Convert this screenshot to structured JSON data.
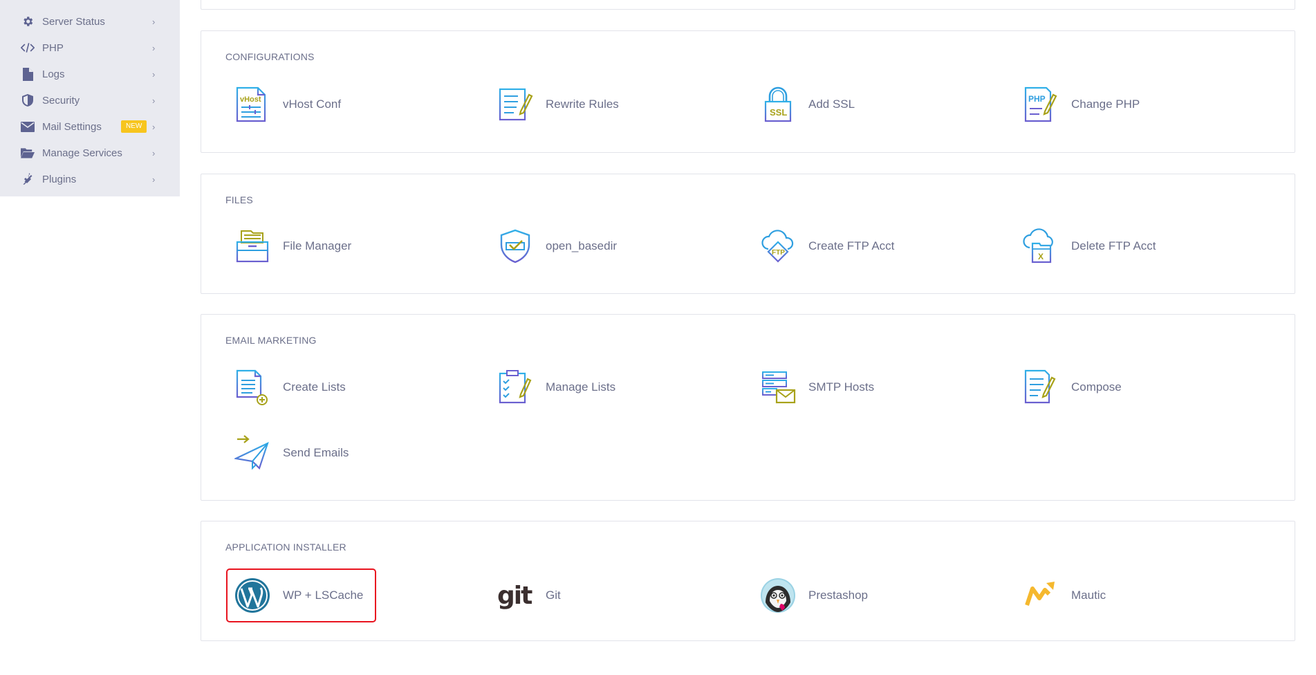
{
  "sidebar": {
    "items": [
      {
        "label": "Server Status",
        "icon": "gear-icon"
      },
      {
        "label": "PHP",
        "icon": "code-icon"
      },
      {
        "label": "Logs",
        "icon": "file-icon"
      },
      {
        "label": "Security",
        "icon": "shield-icon"
      },
      {
        "label": "Mail Settings",
        "icon": "envelope-icon",
        "badge": "NEW"
      },
      {
        "label": "Manage Services",
        "icon": "folder-open-icon"
      },
      {
        "label": "Plugins",
        "icon": "plug-icon"
      }
    ],
    "chevron": "›"
  },
  "sections": {
    "configurations": {
      "title": "CONFIGURATIONS",
      "tiles": [
        {
          "label": "vHost Conf",
          "icon": "vhost-file-icon",
          "icon_text": "vHost"
        },
        {
          "label": "Rewrite Rules",
          "icon": "rewrite-document-icon"
        },
        {
          "label": "Add SSL",
          "icon": "ssl-lock-icon",
          "icon_text": "SSL"
        },
        {
          "label": "Change PHP",
          "icon": "php-file-edit-icon",
          "icon_text": "PHP"
        }
      ]
    },
    "files": {
      "title": "FILES",
      "tiles": [
        {
          "label": "File Manager",
          "icon": "file-cabinet-icon"
        },
        {
          "label": "open_basedir",
          "icon": "shield-check-icon"
        },
        {
          "label": "Create FTP Acct",
          "icon": "cloud-ftp-icon",
          "icon_text": "FTP"
        },
        {
          "label": "Delete FTP Acct",
          "icon": "cloud-delete-icon",
          "icon_text": "X"
        }
      ]
    },
    "email_marketing": {
      "title": "EMAIL MARKETING",
      "tiles": [
        {
          "label": "Create Lists",
          "icon": "create-list-icon"
        },
        {
          "label": "Manage Lists",
          "icon": "checklist-icon"
        },
        {
          "label": "SMTP Hosts",
          "icon": "server-mail-icon"
        },
        {
          "label": "Compose",
          "icon": "compose-icon"
        },
        {
          "label": "Send Emails",
          "icon": "paper-plane-icon"
        }
      ]
    },
    "application_installer": {
      "title": "APPLICATION INSTALLER",
      "tiles": [
        {
          "label": "WP + LSCache",
          "icon": "wordpress-logo-icon",
          "highlighted": true
        },
        {
          "label": "Git",
          "icon": "git-logo-icon",
          "icon_text": "git"
        },
        {
          "label": "Prestashop",
          "icon": "prestashop-logo-icon"
        },
        {
          "label": "Mautic",
          "icon": "mautic-logo-icon"
        }
      ]
    }
  },
  "colors": {
    "sidebar_bg": "#e9eaf0",
    "icon_blue": "#2f9fe0",
    "icon_purple": "#6a5fd0",
    "icon_olive": "#a8a21a",
    "wordpress_blue": "#21759b",
    "mautic_yellow": "#f5b82e",
    "highlight_red": "#e8131f",
    "badge_yellow": "#f7c51e"
  }
}
